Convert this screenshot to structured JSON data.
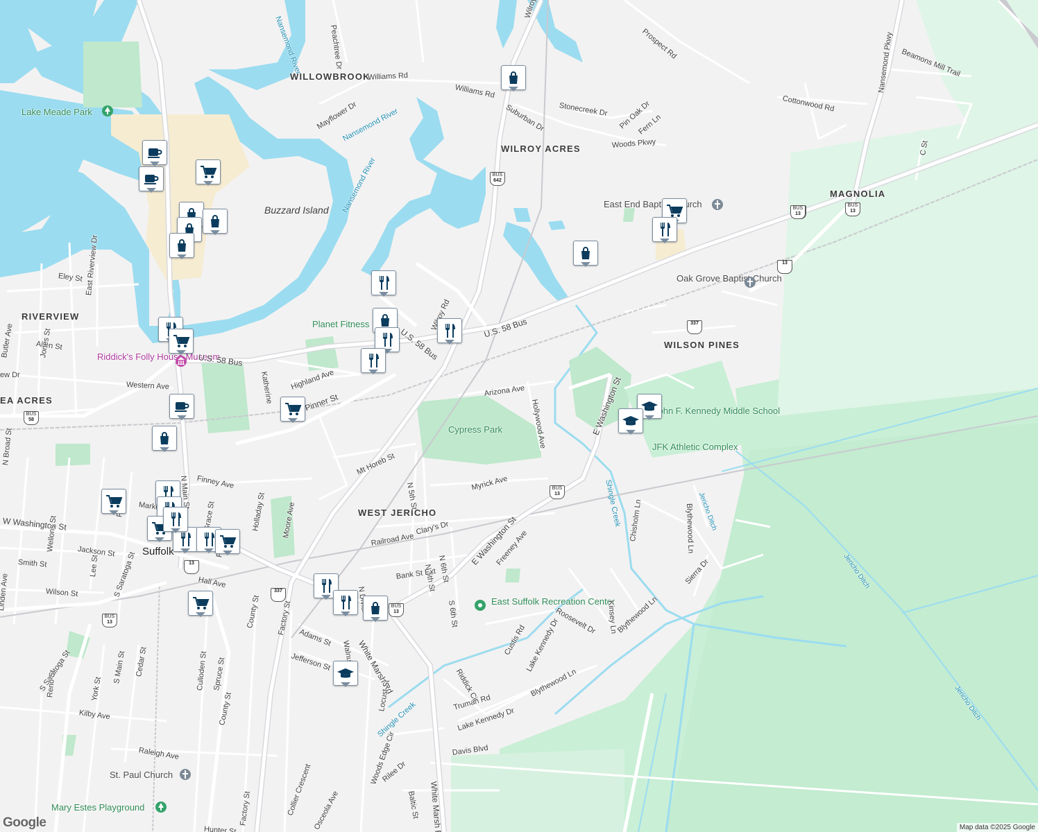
{
  "map": {
    "copyright": "Map data ©2025 Google",
    "logo": "Google",
    "colors": {
      "land": "#f3f2f2",
      "water": "#9bdcf0",
      "park": "#cdeed7",
      "green_area": "#bfe8cc",
      "campus": "#f5ecd3",
      "road": "#ffffff",
      "road_outline": "#d7d7dc",
      "pin_fill": "#0b3c5d"
    }
  },
  "neighborhoods": [
    "WILLOWBROOK",
    "WILROY ACRES",
    "MAGNOLIA",
    "RIVERVIEW",
    "WILSON PINES",
    "WEST JERICHO",
    "EA ACRES"
  ],
  "places": {
    "lake_meade": "Lake Meade Park",
    "buzzard": "Buzzard Island",
    "riddick": "Riddick's Folly House Museum",
    "planet_fitness": "Planet Fitness",
    "cypress": "Cypress Park",
    "east_end": "East End Baptist Church",
    "oak_grove": "Oak Grove Baptist Church",
    "jfk_school": "John F. Kennedy Middle School",
    "jfk_athletic": "JFK Athletic Complex",
    "east_suffolk": "East Suffolk Recreation Center",
    "st_paul": "St. Paul Church",
    "mary_estes": "Mary Estes Playground",
    "suffolk": "Suffolk"
  },
  "water_labels": [
    "Nansemond River",
    "Nansemond River",
    "Nansemond River",
    "Shingle Creek",
    "Shingle Creek",
    "Jericho Ditch",
    "Jericho Ditch",
    "Jericho Ditch"
  ],
  "roads": [
    "Williams Rd",
    "Williams Rd",
    "Mayflower Dr",
    "Peachtree Dr",
    "Wilroy Rd",
    "Wilroy Rd",
    "Suburban Dr",
    "Stonecreek Dr",
    "Pin Oak Dr",
    "Fern Ln",
    "Woods Pkwy",
    "Prospect Rd",
    "Nansemond Pkwy",
    "Beamons Mill Trail",
    "Cottonwood Rd",
    "C St",
    "U.S. 58 Bus",
    "U.S. 58 Bus",
    "U.S. 58 Bus",
    "Highland Ave",
    "Katherine",
    "Pinner St",
    "Western Ave",
    "Arizona Ave",
    "Hollywood Ave",
    "E Washington St",
    "E Washington St",
    "Mt Horeb St",
    "Finney Ave",
    "Myrick Ave",
    "N 5th St",
    "N 6th St",
    "N 5th St",
    "Clary's Dr",
    "Railroad Ave",
    "Bank St Ext",
    "Freeney Ave",
    "N Divisi",
    "S 6th St",
    "Adams St",
    "Jefferson St",
    "Walnut St",
    "White Marsh Rd",
    "White Marsh Rd",
    "Locust St",
    "Factory St",
    "Factory St",
    "County St",
    "County St",
    "Moore Ave",
    "Holladay St",
    "Eley St",
    "Allen St",
    "Jones St",
    "East Riverview Dr",
    "Butler Ave",
    "N Broad St",
    "N Main St",
    "W Washington St",
    "Jackson St",
    "Wellons St",
    "Smith St",
    "Lee St",
    "S Saratoga St",
    "S Saratoga St",
    "Wilson St",
    "Hall Ave",
    "Linden Ave",
    "Pine St",
    "Market",
    "Culloden St",
    "Spruce St",
    "Cedar St",
    "S Main St",
    "York St",
    "Reno St",
    "Kilby Ave",
    "Raleigh Ave",
    "Collier Crescent",
    "Osceola Ave",
    "Hunter St",
    "Woods Edge Cir",
    "Rilee Dr",
    "Baltic St",
    "Davis Blvd",
    "Truman Rd",
    "Lake Kennedy Dr",
    "Lake Kennedy Dr",
    "Riddick Cir",
    "Custis Rd",
    "Roosevelt Dr",
    "Blythewood Ln",
    "Blythewood Ln",
    "Blythewood Ln",
    "Kinsey Ln",
    "Chisholm Ln",
    "Sierra Dr",
    "Grace St",
    "Frank",
    "ew Dr"
  ],
  "shields": [
    {
      "top": "BUS",
      "num": "642"
    },
    {
      "top": "BUS",
      "num": "460"
    },
    {
      "top": "BUS",
      "num": "13"
    },
    {
      "top": "BUS",
      "num": "13"
    },
    {
      "top": "",
      "num": "337"
    },
    {
      "top": "BUS",
      "num": "58"
    },
    {
      "top": "BUS",
      "num": "13"
    },
    {
      "top": "",
      "num": "13"
    },
    {
      "top": "BUS",
      "num": "13"
    },
    {
      "top": "",
      "num": "337"
    },
    {
      "top": "BUS",
      "num": "13"
    },
    {
      "top": "BUS",
      "num": "13"
    },
    {
      "top": "BUS",
      "num": "13"
    },
    {
      "top": "",
      "num": "13"
    }
  ],
  "markers": [
    {
      "type": "shopping-bag",
      "name": "shopping-marker"
    },
    {
      "type": "coffee",
      "name": "cafe-marker"
    },
    {
      "type": "coffee",
      "name": "cafe-marker"
    },
    {
      "type": "cart",
      "name": "grocery-marker"
    },
    {
      "type": "shopping-bag",
      "name": "shopping-marker"
    },
    {
      "type": "shopping-bag",
      "name": "shopping-marker"
    },
    {
      "type": "shopping-bag",
      "name": "shopping-marker"
    },
    {
      "type": "shopping-bag",
      "name": "shopping-marker"
    },
    {
      "type": "fork-knife",
      "name": "restaurant-marker"
    },
    {
      "type": "shopping-bag",
      "name": "shopping-marker"
    },
    {
      "type": "fork-knife",
      "name": "restaurant-marker"
    },
    {
      "type": "fork-knife",
      "name": "restaurant-marker"
    },
    {
      "type": "fork-knife",
      "name": "restaurant-marker"
    },
    {
      "type": "fork-knife",
      "name": "restaurant-marker"
    },
    {
      "type": "cart",
      "name": "grocery-marker"
    },
    {
      "type": "coffee",
      "name": "cafe-marker"
    },
    {
      "type": "shopping-bag",
      "name": "shopping-marker"
    },
    {
      "type": "cart",
      "name": "grocery-marker"
    },
    {
      "type": "cart",
      "name": "grocery-marker"
    },
    {
      "type": "fork-knife",
      "name": "restaurant-marker"
    },
    {
      "type": "fork-knife",
      "name": "restaurant-marker"
    },
    {
      "type": "cart",
      "name": "grocery-marker"
    },
    {
      "type": "fork-knife",
      "name": "restaurant-marker"
    },
    {
      "type": "fork-knife",
      "name": "restaurant-marker"
    },
    {
      "type": "cart",
      "name": "grocery-marker"
    },
    {
      "type": "fork-knife",
      "name": "restaurant-marker"
    },
    {
      "type": "fork-knife",
      "name": "restaurant-marker"
    },
    {
      "type": "shopping-bag",
      "name": "shopping-marker"
    },
    {
      "type": "cart",
      "name": "grocery-marker"
    },
    {
      "type": "graduation-cap",
      "name": "school-marker"
    },
    {
      "type": "shopping-bag",
      "name": "shopping-marker"
    },
    {
      "type": "cart",
      "name": "grocery-marker"
    },
    {
      "type": "fork-knife",
      "name": "restaurant-marker"
    },
    {
      "type": "graduation-cap",
      "name": "school-marker"
    },
    {
      "type": "graduation-cap",
      "name": "school-marker"
    },
    {
      "type": "fork-knife",
      "name": "restaurant-marker"
    }
  ]
}
